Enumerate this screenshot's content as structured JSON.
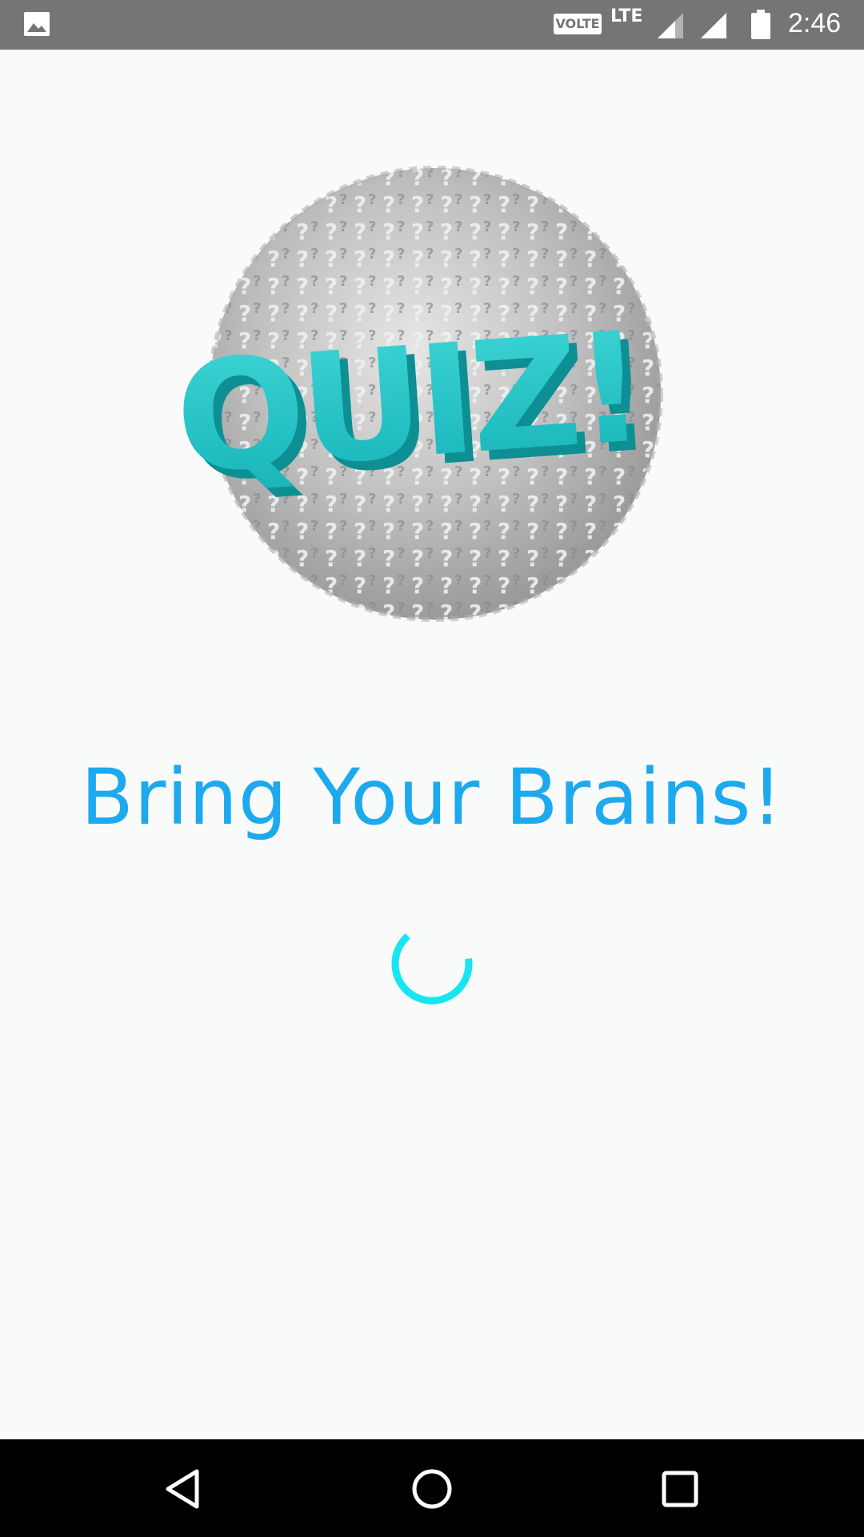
{
  "status_bar": {
    "left_icon": "image-icon",
    "volte_label": "VOLTE",
    "network_label": "LTE",
    "time": "2:46"
  },
  "splash": {
    "logo_text": "QUIZ!",
    "tagline": "Bring Your Brains!",
    "loading_indicator": "loading-spinner"
  },
  "nav_bar": {
    "back_icon": "back-triangle-icon",
    "home_icon": "home-circle-icon",
    "recents_icon": "recents-square-icon"
  },
  "colors": {
    "status_bar_bg": "#757575",
    "background": "#f9fafa",
    "tagline": "#1da9ee",
    "logo_teal": "#24c8c8",
    "spinner": "#17e6f0",
    "nav_bar_bg": "#000000"
  }
}
